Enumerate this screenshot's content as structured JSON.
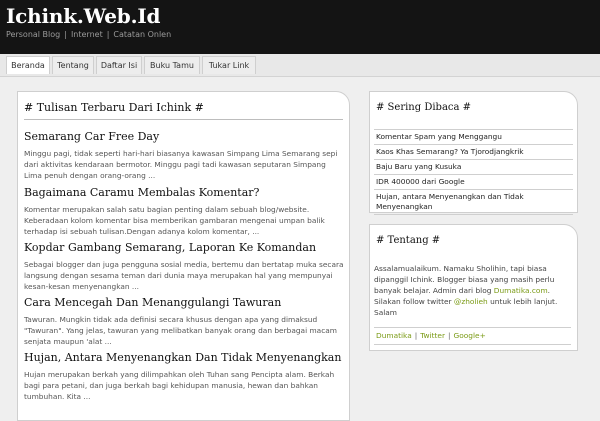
{
  "header": {
    "site_title": "Ichink.Web.Id",
    "tagline": [
      "Personal Blog",
      "Internet",
      "Catatan Onlen"
    ]
  },
  "nav": {
    "items": [
      "Beranda",
      "Tentang",
      "Daftar Isi",
      "Buku Tamu",
      "Tukar Link"
    ],
    "active": "Beranda"
  },
  "main": {
    "title": "# Tulisan Terbaru Dari Ichink #",
    "posts": [
      {
        "title": "Semarang Car Free Day",
        "excerpt": "Minggu pagi, tidak seperti hari-hari biasanya kawasan Simpang Lima Semarang sepi dari aktivitas kendaraan bermotor. Minggu pagi tadi kawasan seputaran Simpang Lima penuh dengan orang-orang ..."
      },
      {
        "title": "Bagaimana Caramu Membalas Komentar?",
        "excerpt": "Komentar merupakan salah satu bagian penting dalam sebuah blog/website. Keberadaan kolom komentar bisa memberikan gambaran mengenai umpan balik terhadap isi sebuah tulisan.Dengan adanya kolom komentar, ..."
      },
      {
        "title": "Kopdar Gambang Semarang, Laporan Ke Komandan",
        "excerpt": "Sebagai blogger dan juga pengguna sosial media, bertemu dan bertatap muka secara langsung dengan sesama teman dari dunia maya merupakan hal yang mempunyai kesan-kesan menyenangkan ..."
      },
      {
        "title": "Cara Mencegah Dan Menanggulangi Tawuran",
        "excerpt": "Tawuran. Mungkin tidak ada definisi secara khusus dengan apa yang dimaksud \"Tawuran\". Yang jelas, tawuran yang melibatkan banyak orang dan berbagai macam senjata maupun 'alat ..."
      },
      {
        "title": "Hujan, Antara Menyenangkan Dan Tidak Menyenangkan",
        "excerpt": "Hujan merupakan berkah yang dilimpahkan oleh Tuhan sang Pencipta alam. Berkah bagi para petani, dan juga berkah bagi kehidupan manusia, hewan dan bahkan tumbuhan. Kita ..."
      }
    ]
  },
  "sidebar": {
    "popular": {
      "title": "# Sering Dibaca #",
      "items": [
        "Komentar Spam yang Menggangu",
        "Kaos Khas Semarang? Ya Tjorodjangkrik",
        "Baju Baru yang Kusuka",
        "IDR 400000 dari Google",
        "Hujan, antara Menyenangkan dan Tidak Menyenangkan"
      ]
    },
    "about": {
      "title": "# Tentang #",
      "text_before": "Assalamualaikum. Namaku Sholihin, tapi biasa dipanggil Ichink. Blogger biasa yang masih perlu banyak belajar. Admin dari blog ",
      "link1": "Dumatika.com",
      "text_middle": ". Silakan follow twitter ",
      "link2": "@zholieh",
      "text_after": " untuk lebih lanjut. Salam",
      "links": [
        "Dumatika",
        "Twitter",
        "Google+"
      ]
    }
  },
  "colors": {
    "header_bg": "#141414",
    "link_green": "#7a9a14"
  }
}
